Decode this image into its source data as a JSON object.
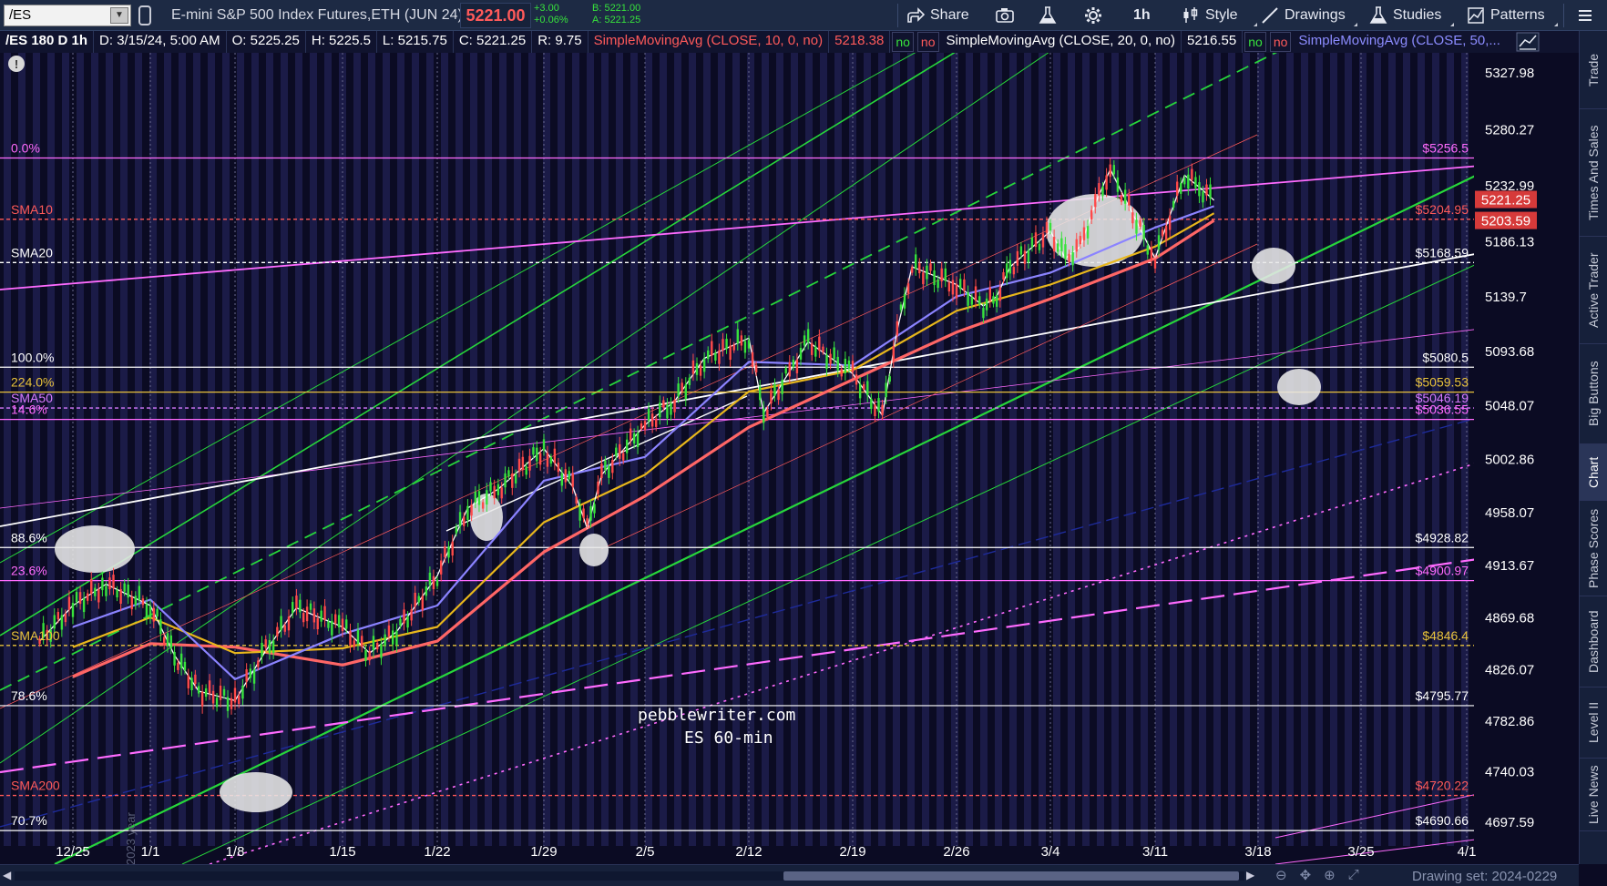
{
  "toolbar": {
    "symbol": "/ES",
    "instrument_name": "E-mini S&P 500 Index Futures,ETH (JUN 24)",
    "last_price": "5221.00",
    "change": "+3.00",
    "change_pct": "+0.06%",
    "bid": "B: 5221.00",
    "ask": "A: 5221.25",
    "share_label": "Share",
    "timeframe_label": "1h",
    "style_label": "Style",
    "drawings_label": "Drawings",
    "studies_label": "Studies",
    "patterns_label": "Patterns"
  },
  "infobar": {
    "title": "/ES 180 D 1h",
    "date": "D: 3/15/24, 5:00 AM",
    "open": "O: 5225.25",
    "high": "H: 5225.5",
    "low": "L: 5215.75",
    "close": "C: 5221.25",
    "range": "R: 9.75",
    "sma10_label": "SimpleMovingAvg (CLOSE, 10, 0, no)",
    "sma10_value": "5218.38",
    "sma20_label": "SimpleMovingAvg (CLOSE, 20, 0, no)",
    "sma20_value": "5216.55",
    "sma50_label": "SimpleMovingAvg (CLOSE, 50,...",
    "flag_no": "no"
  },
  "right_panel": [
    "Trade",
    "Times And Sales",
    "Active Trader",
    "Big Buttons",
    "Chart",
    "Phase Scores",
    "Dashboard",
    "Level II",
    "Live News"
  ],
  "right_panel_active": "Chart",
  "chart_data": {
    "type": "candlestick",
    "x_ticks": [
      "12/25",
      "1/1",
      "1/8",
      "1/15",
      "1/22",
      "1/29",
      "2/5",
      "2/12",
      "2/19",
      "2/26",
      "3/4",
      "3/11",
      "3/18",
      "3/25",
      "4/1"
    ],
    "y_ticks": [
      5327.98,
      5280.27,
      5232.99,
      5186.13,
      5139.7,
      5093.68,
      5048.07,
      5002.86,
      4958.07,
      4913.67,
      4869.68,
      4826.07,
      4782.86,
      4740.03,
      4697.59
    ],
    "ylim": [
      4690,
      5345
    ],
    "current_price_box": "5221.25",
    "sma200_price_box": "5203.59",
    "year_label": "2023 year",
    "watermark": [
      "pebblewriter.com",
      "ES 60-min"
    ],
    "horizontal_levels": [
      {
        "left": "0.0%",
        "right": "$5256.5",
        "value": 5256.5,
        "color": "#ff6bff",
        "style": "solid"
      },
      {
        "left": "SMA10",
        "right": "$5204.95",
        "value": 5204.95,
        "color": "#ff5a5a",
        "style": "dashed"
      },
      {
        "left": "SMA20",
        "right": "$5168.59",
        "value": 5168.59,
        "color": "#ffffff",
        "style": "dashed"
      },
      {
        "left": "100.0%",
        "right": "$5080.5",
        "value": 5080.5,
        "color": "#ffffff",
        "style": "solid"
      },
      {
        "left": "224.0%",
        "right": "$5059.53",
        "value": 5059.53,
        "color": "#e8c23c",
        "style": "solid"
      },
      {
        "left": "SMA50",
        "right": "$5046.19",
        "value": 5046.19,
        "color": "#d77aff",
        "style": "dashed"
      },
      {
        "left": "14.6%",
        "right": "$5036.55",
        "value": 5036.55,
        "color": "#ff6bff",
        "style": "solid"
      },
      {
        "left": "88.6%",
        "right": "$4928.82",
        "value": 4928.82,
        "color": "#ffffff",
        "style": "solid"
      },
      {
        "left": "23.6%",
        "right": "$4900.97",
        "value": 4900.97,
        "color": "#ff6bff",
        "style": "solid"
      },
      {
        "left": "SMA100",
        "right": "$4846.4",
        "value": 4846.4,
        "color": "#e8c23c",
        "style": "dashed"
      },
      {
        "left": "78.6%",
        "right": "$4795.77",
        "value": 4795.77,
        "color": "#ffffff",
        "style": "solid"
      },
      {
        "left": "SMA200",
        "right": "$4720.22",
        "value": 4720.22,
        "color": "#ff5a5a",
        "style": "dashed"
      },
      {
        "left": "70.7%",
        "right": "$4690.66",
        "value": 4690.66,
        "color": "#ffffff",
        "style": "solid"
      }
    ],
    "close_series": [
      [
        "12/22",
        4850
      ],
      [
        "12/25",
        4880
      ],
      [
        "12/28",
        4898
      ],
      [
        "1/1",
        4880
      ],
      [
        "1/3",
        4838
      ],
      [
        "1/5",
        4808
      ],
      [
        "1/8",
        4800
      ],
      [
        "1/10",
        4842
      ],
      [
        "1/12",
        4878
      ],
      [
        "1/15",
        4862
      ],
      [
        "1/17",
        4840
      ],
      [
        "1/19",
        4858
      ],
      [
        "1/22",
        4905
      ],
      [
        "1/24",
        4962
      ],
      [
        "1/26",
        4978
      ],
      [
        "1/29",
        5012
      ],
      [
        "1/31",
        4980
      ],
      [
        "2/1",
        4945
      ],
      [
        "2/2",
        4990
      ],
      [
        "2/5",
        5032
      ],
      [
        "2/7",
        5052
      ],
      [
        "2/9",
        5088
      ],
      [
        "2/12",
        5105
      ],
      [
        "2/13",
        5042
      ],
      [
        "2/15",
        5082
      ],
      [
        "2/16",
        5102
      ],
      [
        "2/19",
        5075
      ],
      [
        "2/21",
        5040
      ],
      [
        "2/22",
        5112
      ],
      [
        "2/23",
        5165
      ],
      [
        "2/26",
        5150
      ],
      [
        "2/28",
        5132
      ],
      [
        "2/29",
        5140
      ],
      [
        "3/1",
        5165
      ],
      [
        "3/4",
        5195
      ],
      [
        "3/5",
        5172
      ],
      [
        "3/6",
        5182
      ],
      [
        "3/7",
        5218
      ],
      [
        "3/8",
        5247
      ],
      [
        "3/11",
        5172
      ],
      [
        "3/12",
        5208
      ],
      [
        "3/13",
        5242
      ],
      [
        "3/14",
        5232
      ],
      [
        "3/15",
        5221
      ]
    ],
    "sma20_series": [
      [
        "12/25",
        4862
      ],
      [
        "1/1",
        4885
      ],
      [
        "1/8",
        4818
      ],
      [
        "1/15",
        4856
      ],
      [
        "1/22",
        4880
      ],
      [
        "1/29",
        4985
      ],
      [
        "2/5",
        5005
      ],
      [
        "2/12",
        5085
      ],
      [
        "2/19",
        5082
      ],
      [
        "2/26",
        5140
      ],
      [
        "3/4",
        5160
      ],
      [
        "3/11",
        5198
      ],
      [
        "3/15",
        5216
      ]
    ],
    "sma50_series": [
      [
        "12/25",
        4845
      ],
      [
        "1/1",
        4870
      ],
      [
        "1/8",
        4840
      ],
      [
        "1/15",
        4844
      ],
      [
        "1/22",
        4862
      ],
      [
        "1/29",
        4950
      ],
      [
        "2/5",
        4990
      ],
      [
        "2/12",
        5060
      ],
      [
        "2/19",
        5078
      ],
      [
        "2/26",
        5128
      ],
      [
        "3/4",
        5150
      ],
      [
        "3/11",
        5182
      ],
      [
        "3/15",
        5210
      ]
    ],
    "sma200_series": [
      [
        "12/25",
        4820
      ],
      [
        "1/1",
        4848
      ],
      [
        "1/8",
        4845
      ],
      [
        "1/15",
        4830
      ],
      [
        "1/22",
        4850
      ],
      [
        "1/29",
        4925
      ],
      [
        "2/5",
        4972
      ],
      [
        "2/12",
        5030
      ],
      [
        "2/19",
        5070
      ],
      [
        "2/26",
        5110
      ],
      [
        "3/4",
        5138
      ],
      [
        "3/11",
        5172
      ],
      [
        "3/15",
        5204
      ]
    ]
  },
  "scrollbar": {
    "drawing_set": "Drawing set: 2024-0229"
  }
}
